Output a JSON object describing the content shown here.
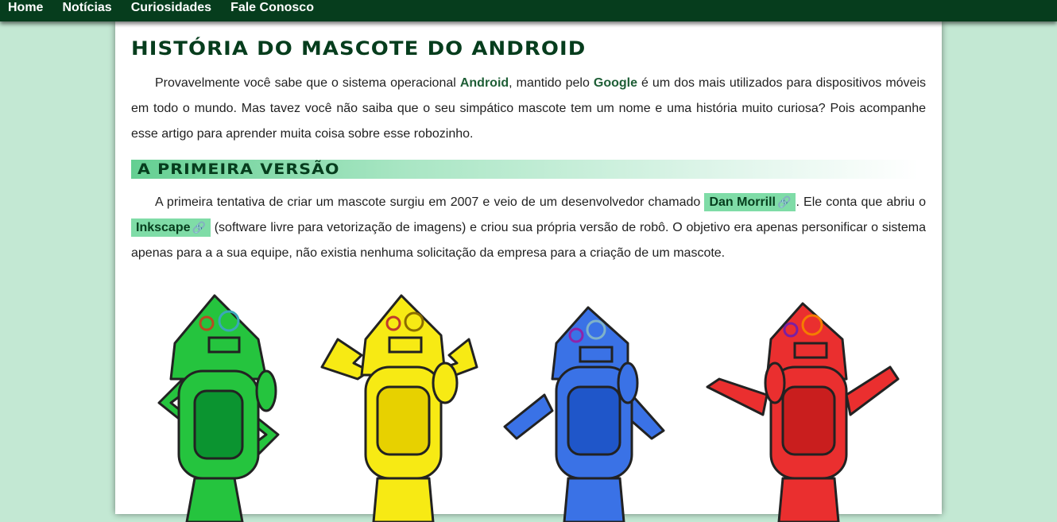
{
  "nav": {
    "items": [
      "Home",
      "Notícias",
      "Curiosidades",
      "Fale Conosco"
    ]
  },
  "article": {
    "title": "História do mascote do Android",
    "intro": {
      "part1": "Provavelmente você sabe que o sistema operacional ",
      "android": "Android",
      "part2": ", mantido pelo ",
      "google": "Google",
      "part3": " é um dos mais utilizados para dispositivos móveis em todo o mundo. Mas tavez você não saiba que o seu simpático mascote tem um nome e uma história muito curiosa? Pois acompanhe esse artigo para aprender muita coisa sobre esse robozinho."
    },
    "section1": {
      "heading": "A primeira versão",
      "text1": "A primeira tentativa de criar um mascote surgiu em 2007 e veio de um desenvolvedor chamado ",
      "link1": "Dan Morrill",
      "text2": ". Ele conta que abriu o ",
      "link2": "Inkscape",
      "text3": " (software livre para vetorização de imagens) e criou sua própria versão de robô. O objetivo era apenas personificar o sistema apenas para a a sua equipe, não existia nenhuma solicitação da empresa para a criação de um mascote."
    },
    "link_icon": "🔗"
  },
  "colors": {
    "nav_bg": "#063d1d",
    "page_bg": "#c3e8d3",
    "pill_bg": "#7fdca7",
    "robot_colors": [
      "#25c43e",
      "#f7ea14",
      "#3a72e6",
      "#ea2f2f"
    ]
  }
}
